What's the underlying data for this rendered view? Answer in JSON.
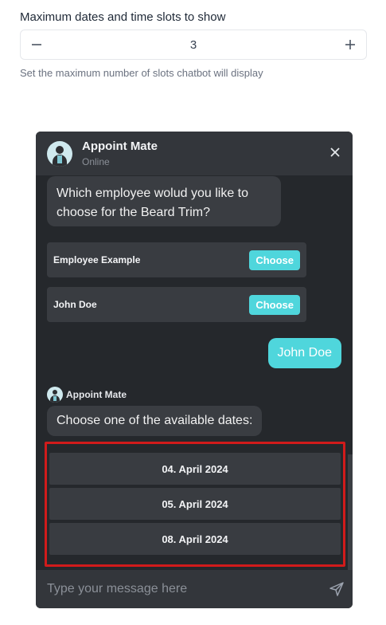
{
  "settings": {
    "label": "Maximum dates and time slots to show",
    "value": "3",
    "decrement_icon": "minus-icon",
    "increment_icon": "plus-icon",
    "help": "Set the maximum number of slots chatbot will display"
  },
  "chat": {
    "title": "Appoint Mate",
    "status": "Online",
    "question": "Which employee wolud you like to choose for the Beard Trim?",
    "employees": [
      {
        "name": "Employee Example",
        "button": "Choose"
      },
      {
        "name": "John Doe",
        "button": "Choose"
      }
    ],
    "user_reply": "John Doe",
    "bot_name": "Appoint Mate",
    "dates_prompt": "Choose one of the available dates:",
    "dates": [
      "04. April 2024",
      "05. April 2024",
      "08. April 2024"
    ],
    "input_placeholder": "Type your message here",
    "colors": {
      "accent": "#4fd6dc",
      "highlight": "#d11b1b",
      "panel": "#25282c"
    }
  }
}
